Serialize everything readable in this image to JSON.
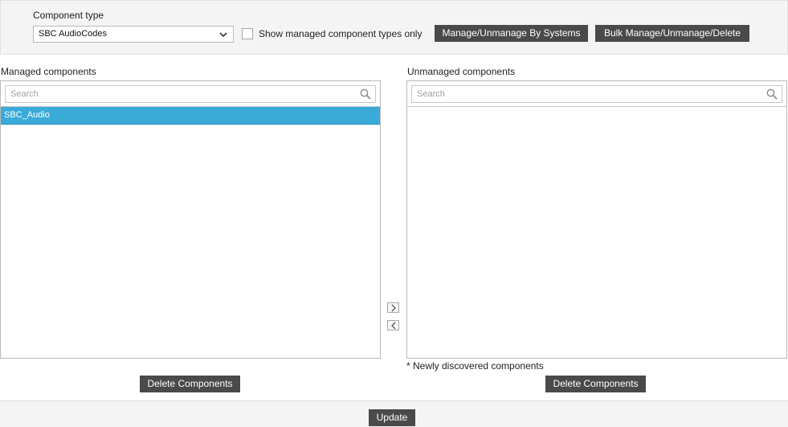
{
  "component_type": {
    "label": "Component type",
    "selected_value": "SBC AudioCodes"
  },
  "filter": {
    "checkbox_label": "Show managed component types only",
    "checked": false
  },
  "toolbar": {
    "manage_by_systems_label": "Manage/Unmanage By Systems",
    "bulk_label": "Bulk Manage/Unmanage/Delete"
  },
  "managed": {
    "title": "Managed components",
    "search_placeholder": "Search",
    "items": [
      "SBC_Audio"
    ],
    "delete_label": "Delete Components"
  },
  "unmanaged": {
    "title": "Unmanaged components",
    "search_placeholder": "Search",
    "items": [],
    "note": "* Newly discovered components",
    "delete_label": "Delete Components"
  },
  "footer": {
    "update_label": "Update"
  },
  "colors": {
    "button_bg": "#4a4a4a",
    "selected_row": "#3aabd9",
    "toolbar_bg": "#f4f4f4"
  }
}
